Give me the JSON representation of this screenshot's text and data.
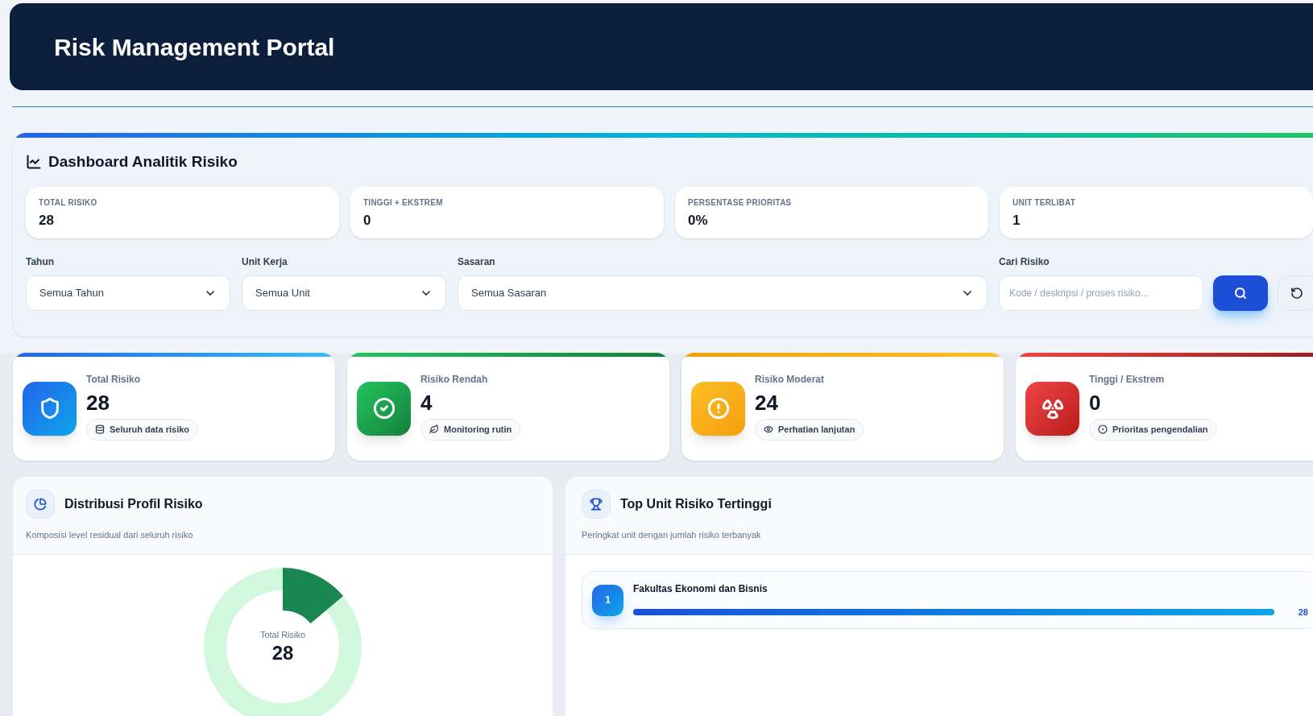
{
  "header": {
    "title": "Risk Management Portal"
  },
  "dashboard": {
    "title": "Dashboard Analitik Risiko",
    "summary": [
      {
        "label": "TOTAL RISIKO",
        "value": "28"
      },
      {
        "label": "TINGGI + EKSTREM",
        "value": "0"
      },
      {
        "label": "PERSENTASE PRIORITAS",
        "value": "0%"
      },
      {
        "label": "UNIT TERLIBAT",
        "value": "1"
      }
    ],
    "filters": [
      {
        "kind": "select",
        "label": "Tahun",
        "value": "Semua Tahun"
      },
      {
        "kind": "select",
        "label": "Unit Kerja",
        "value": "Semua Unit"
      },
      {
        "kind": "select",
        "label": "Sasaran",
        "value": "Semua Sasaran"
      },
      {
        "kind": "search",
        "label": "Cari Risiko",
        "placeholder": "Kode / deskripsi / proses risiko..."
      }
    ]
  },
  "cards": [
    {
      "kind": "total",
      "label": "Total Risiko",
      "value": "28",
      "note": "Seluruh data risiko"
    },
    {
      "kind": "low",
      "label": "Risiko Rendah",
      "value": "4",
      "note": "Monitoring rutin"
    },
    {
      "kind": "moderate",
      "label": "Risiko Moderat",
      "value": "24",
      "note": "Perhatian lanjutan"
    },
    {
      "kind": "high",
      "label": "Tinggi / Ekstrem",
      "value": "0",
      "note": "Prioritas pengendalian"
    }
  ],
  "distribution": {
    "title": "Distribusi Profil Risiko",
    "subtitle": "Komposisi level residual dari seluruh risiko",
    "center_label": "Total Risiko",
    "center_value": "28"
  },
  "top_units": {
    "title": "Top Unit Risiko Tertinggi",
    "subtitle": "Peringkat unit dengan jumlah risiko terbanyak",
    "rows": [
      {
        "rank": "1",
        "name": "Fakultas Ekonomi dan Bisnis",
        "level": 1,
        "count": "28"
      }
    ]
  }
}
